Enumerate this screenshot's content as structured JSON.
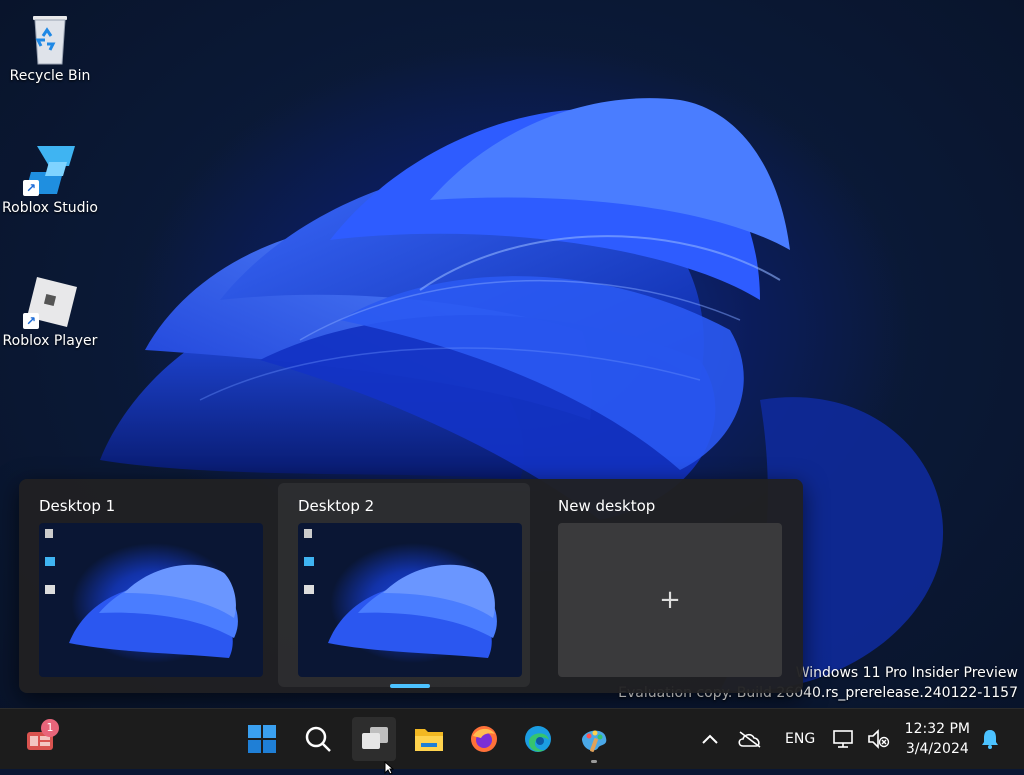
{
  "desktop_icons": [
    {
      "label": "Recycle Bin",
      "icon": "recycle-bin-icon"
    },
    {
      "label": "Roblox Studio",
      "icon": "roblox-studio-icon"
    },
    {
      "label": "Roblox Player",
      "icon": "roblox-player-icon"
    }
  ],
  "watermark": {
    "line1": "Windows 11 Pro Insider Preview",
    "line2": "Evaluation copy. Build 26040.rs_prerelease.240122-1157"
  },
  "task_view": {
    "desktops": [
      {
        "title": "Desktop 1",
        "active": false
      },
      {
        "title": "Desktop 2",
        "active": true
      },
      {
        "title": "New desktop",
        "active": false
      }
    ],
    "new_desktop_symbol": "+"
  },
  "taskbar": {
    "widgets_badge": "1",
    "apps": [
      {
        "name": "start-icon"
      },
      {
        "name": "search-icon"
      },
      {
        "name": "task-view-icon"
      },
      {
        "name": "file-explorer-icon"
      },
      {
        "name": "firefox-icon"
      },
      {
        "name": "edge-icon"
      },
      {
        "name": "paint-icon"
      }
    ],
    "tray": {
      "language": "ENG",
      "time": "12:32 PM",
      "date": "3/4/2024"
    }
  },
  "colors": {
    "accent": "#4cc2ff",
    "taskbar_bg": "#1c1c1c",
    "task_view_bg": "#202022"
  }
}
